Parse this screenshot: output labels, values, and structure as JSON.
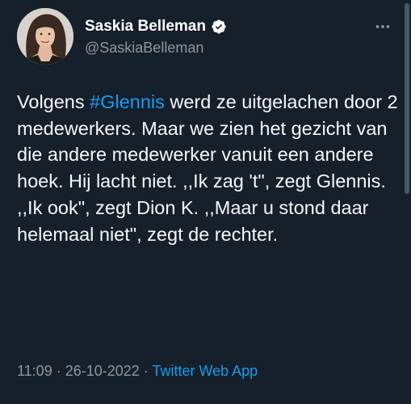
{
  "author": {
    "display_name": "Saskia Belleman",
    "handle": "@SaskiaBelleman",
    "verified": true
  },
  "tweet": {
    "text_before": "Volgens ",
    "hashtag": "#Glennis",
    "text_after": " werd ze uitgelachen door 2 medewerkers. Maar we zien het gezicht van die andere medewerker vanuit een andere hoek. Hij lacht niet. ,,Ik zag 't\", zegt Glennis. ,,Ik ook\", zegt Dion K. ,,Maar u stond daar helemaal niet\", zegt de rechter."
  },
  "meta": {
    "time": "11:09",
    "separator": " · ",
    "date": "26-10-2022",
    "source": "Twitter Web App"
  },
  "icons": {
    "verified": "verified-badge-icon",
    "more": "more-options-icon"
  },
  "colors": {
    "background": "#15202b",
    "accent": "#1d9bf0",
    "secondary_text": "#8b98a5"
  }
}
